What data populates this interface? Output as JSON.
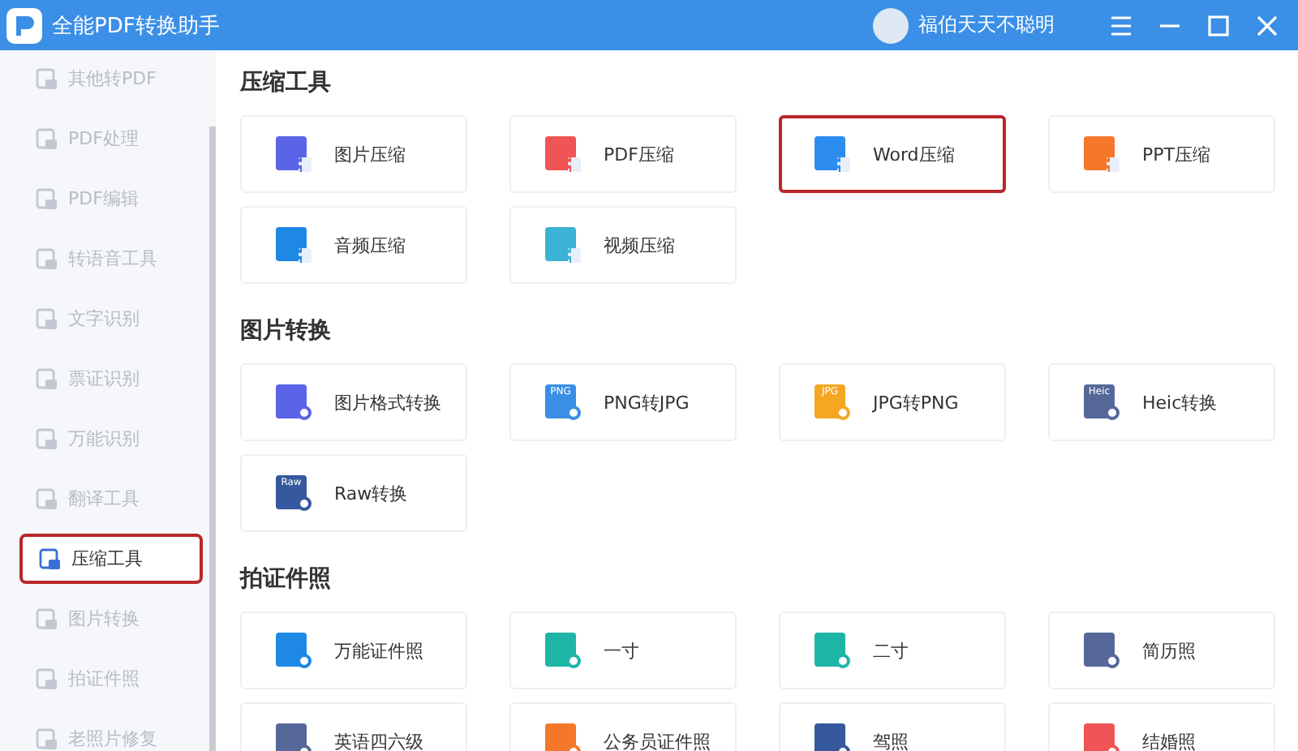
{
  "window": {
    "title": "全能PDF转换助手",
    "user": "福伯天天不聪明"
  },
  "sidebar": {
    "items": [
      {
        "label": "其他转PDF",
        "selected": false
      },
      {
        "label": "PDF处理",
        "selected": false
      },
      {
        "label": "PDF编辑",
        "selected": false
      },
      {
        "label": "转语音工具",
        "selected": false
      },
      {
        "label": "文字识别",
        "selected": false
      },
      {
        "label": "票证识别",
        "selected": false
      },
      {
        "label": "万能识别",
        "selected": false
      },
      {
        "label": "翻译工具",
        "selected": false
      },
      {
        "label": "压缩工具",
        "selected": true,
        "highlighted": true
      },
      {
        "label": "图片转换",
        "selected": false
      },
      {
        "label": "拍证件照",
        "selected": false
      },
      {
        "label": "老照片修复",
        "selected": false
      }
    ]
  },
  "sections": [
    {
      "title": "压缩工具",
      "tools": [
        {
          "label": "图片压缩",
          "kind": "compress",
          "color": "#5b63e6",
          "highlighted": false
        },
        {
          "label": "PDF压缩",
          "kind": "compress",
          "color": "#f05454",
          "highlighted": false
        },
        {
          "label": "Word压缩",
          "kind": "compress",
          "color": "#2d8cf0",
          "highlighted": true
        },
        {
          "label": "PPT压缩",
          "kind": "compress",
          "color": "#f5782a",
          "highlighted": false
        },
        {
          "label": "音频压缩",
          "kind": "compress",
          "color": "#1e88e5",
          "highlighted": false
        },
        {
          "label": "视频压缩",
          "kind": "compress",
          "color": "#3bb3d6",
          "highlighted": false
        }
      ]
    },
    {
      "title": "图片转换",
      "tools": [
        {
          "label": "图片格式转换",
          "kind": "convert",
          "color": "#5b63e6",
          "highlighted": false
        },
        {
          "label": "PNG转JPG",
          "kind": "convert",
          "color": "#3a8ee6",
          "icon_text": "PNG",
          "highlighted": false
        },
        {
          "label": "JPG转PNG",
          "kind": "convert",
          "color": "#f5a623",
          "icon_text": "JPG",
          "highlighted": false
        },
        {
          "label": "Heic转换",
          "kind": "convert",
          "color": "#56689a",
          "icon_text": "Heic",
          "highlighted": false
        },
        {
          "label": "Raw转换",
          "kind": "convert",
          "color": "#35589e",
          "icon_text": "Raw",
          "highlighted": false
        }
      ]
    },
    {
      "title": "拍证件照",
      "tools": [
        {
          "label": "万能证件照",
          "kind": "photo",
          "color": "#1e88e5",
          "highlighted": false
        },
        {
          "label": "一寸",
          "kind": "photo",
          "color": "#1fb5a6",
          "highlighted": false
        },
        {
          "label": "二寸",
          "kind": "photo",
          "color": "#1fb5a6",
          "highlighted": false
        },
        {
          "label": "简历照",
          "kind": "photo",
          "color": "#56689a",
          "highlighted": false
        },
        {
          "label": "英语四六级",
          "kind": "photo",
          "color": "#56689a",
          "highlighted": false
        },
        {
          "label": "公务员证件照",
          "kind": "photo",
          "color": "#f5782a",
          "highlighted": false
        },
        {
          "label": "驾照",
          "kind": "photo",
          "color": "#35589e",
          "highlighted": false
        },
        {
          "label": "结婚照",
          "kind": "photo",
          "color": "#f05454",
          "highlighted": false
        }
      ]
    }
  ]
}
